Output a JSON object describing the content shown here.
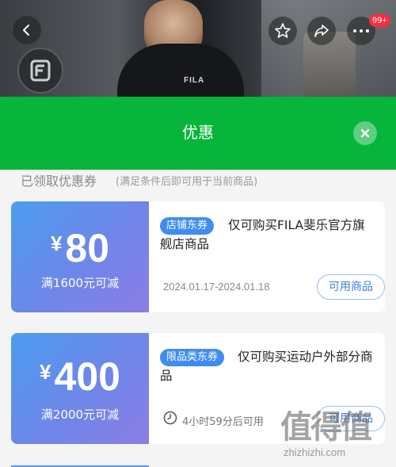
{
  "hero": {
    "brand_text": "FILA",
    "badge": "99+"
  },
  "sheet": {
    "title": "优惠"
  },
  "section": {
    "title": "已领取优惠券",
    "subtitle": "(满足条件后即可用于当前商品)"
  },
  "coupons": [
    {
      "currency": "¥",
      "amount": "80",
      "condition": "满1600元可减",
      "tag": "店铺东券",
      "description": "仅可购买FILA斐乐官方旗舰店商品",
      "date_range": "2024.01.17-2024.01.18",
      "button_label": "可用商品"
    },
    {
      "currency": "¥",
      "amount": "400",
      "condition": "满2000元可减",
      "tag": "限品类东券",
      "description": "仅可购买运动户外部分商品",
      "countdown": "4小时59分后可用",
      "button_label": "可用商品"
    }
  ],
  "watermark": {
    "text": "值得值",
    "url": "zhizhizhi.com"
  },
  "colors": {
    "header_green": "#07b53b",
    "coupon_blue": "#4c9df1",
    "tag_blue": "#3f8df0"
  }
}
